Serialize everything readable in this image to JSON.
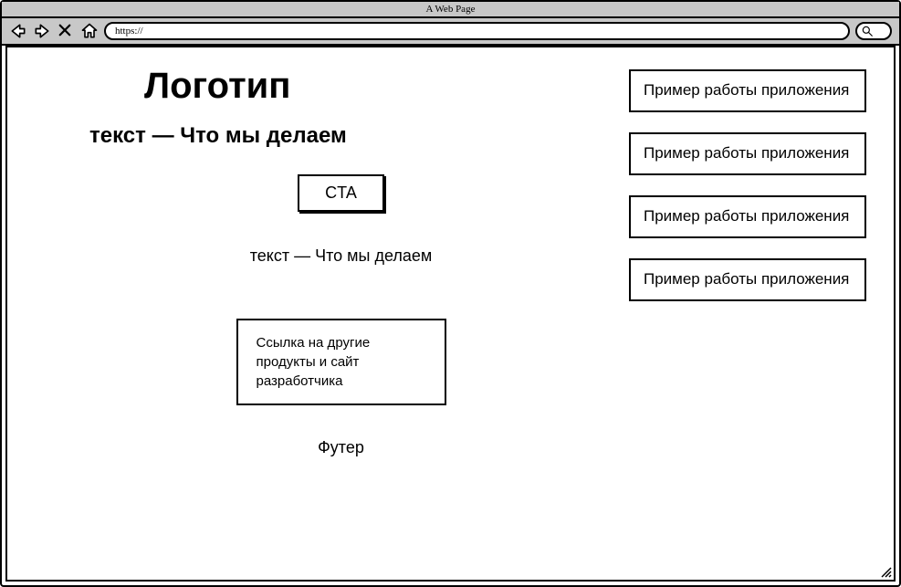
{
  "browser": {
    "title": "A Web Page",
    "url": "https://"
  },
  "main": {
    "logo": "Логотип",
    "headline": "текст — Что мы делаем",
    "cta_label": "CTA",
    "sub_headline": "текст — Что мы делаем",
    "link_box": "Ссылка на другие продукты и сайт разработчика",
    "footer": "Футер"
  },
  "examples": [
    {
      "label": "Пример работы приложения"
    },
    {
      "label": "Пример работы приложения"
    },
    {
      "label": "Пример работы приложения"
    },
    {
      "label": "Пример работы приложения"
    }
  ]
}
